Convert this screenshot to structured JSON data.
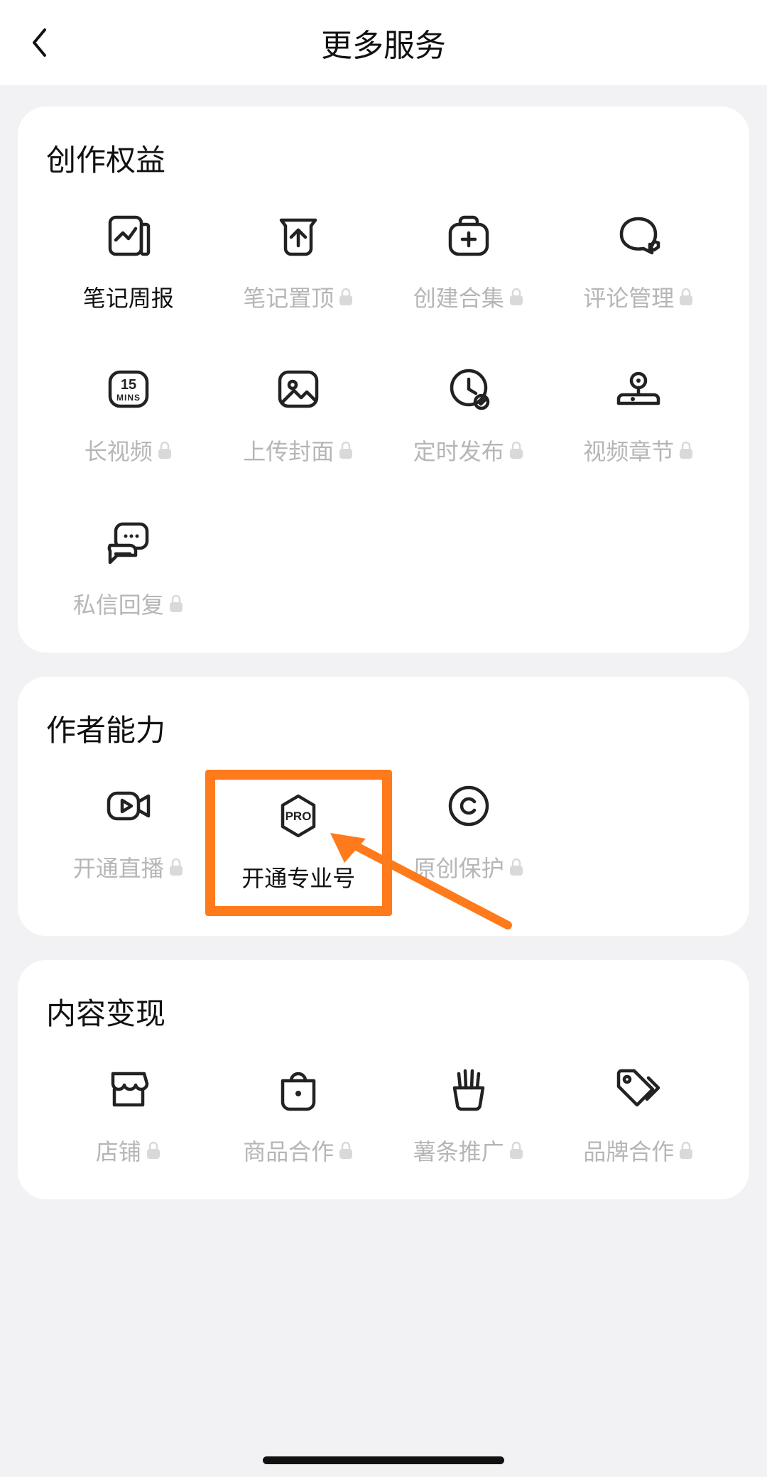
{
  "header": {
    "title": "更多服务"
  },
  "sections": {
    "creation": {
      "title": "创作权益",
      "items": [
        {
          "label": "笔记周报",
          "locked": false
        },
        {
          "label": "笔记置顶",
          "locked": true
        },
        {
          "label": "创建合集",
          "locked": true
        },
        {
          "label": "评论管理",
          "locked": true
        },
        {
          "label": "长视频",
          "locked": true
        },
        {
          "label": "上传封面",
          "locked": true
        },
        {
          "label": "定时发布",
          "locked": true
        },
        {
          "label": "视频章节",
          "locked": true
        },
        {
          "label": "私信回复",
          "locked": true
        }
      ]
    },
    "ability": {
      "title": "作者能力",
      "items": [
        {
          "label": "开通直播",
          "locked": true
        },
        {
          "label": "开通专业号",
          "locked": false,
          "highlighted": true
        },
        {
          "label": "原创保护",
          "locked": true
        }
      ]
    },
    "monetize": {
      "title": "内容变现",
      "items": [
        {
          "label": "店铺",
          "locked": true
        },
        {
          "label": "商品合作",
          "locked": true
        },
        {
          "label": "薯条推广",
          "locked": true
        },
        {
          "label": "品牌合作",
          "locked": true
        }
      ]
    }
  },
  "annotation": {
    "highlight_color": "#ff7a1a"
  }
}
